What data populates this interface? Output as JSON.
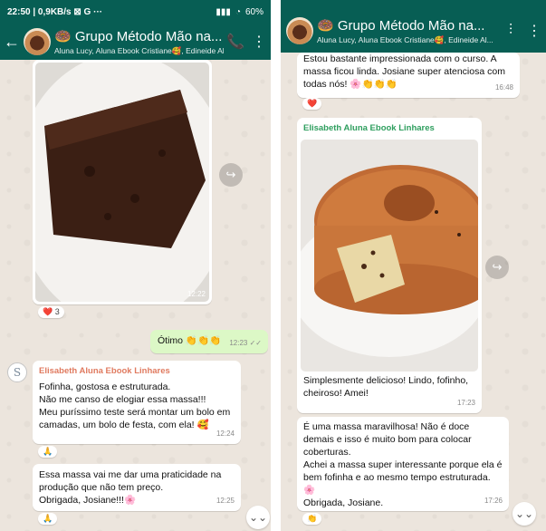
{
  "left": {
    "status": {
      "text": "22:50 | 0,9KB/s ⊠ G ···",
      "battery": "60%"
    },
    "header": {
      "title": "Grupo Método Mão na...",
      "subtitle": "Aluna  Lucy, Aluna Ebook Cristiane🥰, Edineide Al..."
    },
    "img1": {
      "time": "12:22",
      "reaction": "❤️ 3"
    },
    "out1": {
      "text": "Ótimo 👏👏👏",
      "time": "12:23 ✓✓"
    },
    "msg1": {
      "sender": "Elisabeth Aluna Ebook Linhares",
      "text": "Fofinha, gostosa e estruturada.\nNão me canso de elogiar essa massa!!!\nMeu puríssimo teste será montar um bolo em camadas, um bolo de festa, com ela! 🥰",
      "time": "12:24",
      "reaction": "🙏"
    },
    "msg2": {
      "text": "Essa massa vai me dar uma praticidade na produção que não tem preço.\nObrigada, Josiane!!!🌸",
      "time": "12:25",
      "reaction": "🙏"
    }
  },
  "right": {
    "header": {
      "title": "Grupo Método Mão na...",
      "subtitle": "Aluna  Lucy, Aluna Ebook Cristiane🥰, Edineide Al..."
    },
    "msg0": {
      "text": "Estou bastante impressionada com o curso. A massa ficou linda. Josiane super atenciosa com todas nós! 🌸👏👏👏",
      "time": "16:48",
      "reaction": "❤️"
    },
    "img2": {
      "sender": "Elisabeth Aluna Ebook Linhares",
      "caption": "Simplesmente delicioso! Lindo, fofinho, cheiroso! Amei!",
      "time": "17:23"
    },
    "msg3": {
      "text": "É uma massa maravilhosa! Não é doce demais e isso é muito bom para colocar coberturas.\nAchei a massa super interessante porque ela é bem fofinha e ao mesmo tempo estruturada. 🌸\nObrigada, Josiane.",
      "time": "17:26",
      "reaction": "👏"
    }
  },
  "icons": {
    "avatar_letter": "S",
    "forward": "↪",
    "scroll": "⌄⌄"
  },
  "colors": {
    "header": "#075e54",
    "wallpaper": "#ece5dd",
    "outgoing": "#dcf8c6",
    "sender_left": "#e07a5f",
    "sender_right": "#2e9e5e"
  }
}
